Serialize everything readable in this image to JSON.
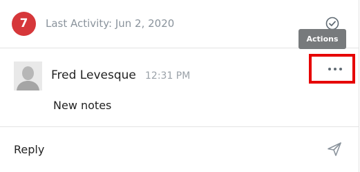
{
  "header": {
    "activity_count": "7",
    "last_activity": "Last Activity: Jun 2, 2020",
    "tooltip": "Actions"
  },
  "message": {
    "author": "Fred Levesque",
    "time": "12:31 PM",
    "body": "New notes"
  },
  "reply": {
    "label": "Reply"
  },
  "colors": {
    "badge": "#d6373a",
    "highlight": "#e60000",
    "tooltip_bg": "#777a7c",
    "muted_text": "#8a939c"
  },
  "icons": [
    "check-circle-icon",
    "more-actions-icon",
    "send-icon",
    "avatar-placeholder"
  ]
}
